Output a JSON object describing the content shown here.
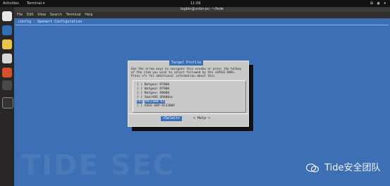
{
  "topbar": {
    "activities": "Activities",
    "app": "Terminal ▾",
    "clock": "11:09",
    "tray": "⊞ ◉ ▾"
  },
  "window": {
    "title": "logbin@unbn-pc: ~/fede",
    "menus": [
      "File",
      "Edit",
      "View",
      "Search",
      "Terminal",
      "Help"
    ]
  },
  "config_header": ".config - Openwrt Configuration",
  "dialog": {
    "title": "Target Profile",
    "help": "Use the arrow keys to navigate this window or press the hotkey of the item you wish to select followed by the <SPACE BAR>. Press <?> for additional information about this",
    "items": [
      {
        "mark": "( )",
        "label": "Netgear R7800"
      },
      {
        "mark": "( )",
        "label": "Netgear R7900"
      },
      {
        "mark": "( )",
        "label": "Netgear R8000"
      },
      {
        "mark": "( )",
        "label": "SmartRG SR400ac"
      },
      {
        "mark": "(X)",
        "label": "Phicomm K3",
        "selected": true
      },
      {
        "mark": "( )",
        "label": "ASUS GRP-AC3300F"
      }
    ],
    "select_label": "<Select>",
    "help_label": "< Help >"
  },
  "watermark": "TIDE SEC",
  "wechat_label": "Tide安全团队",
  "colors": {
    "terminal_bg": "#3c6fb3",
    "dialog_bg": "#c9c9c9",
    "highlight": "#3c6fb3"
  }
}
